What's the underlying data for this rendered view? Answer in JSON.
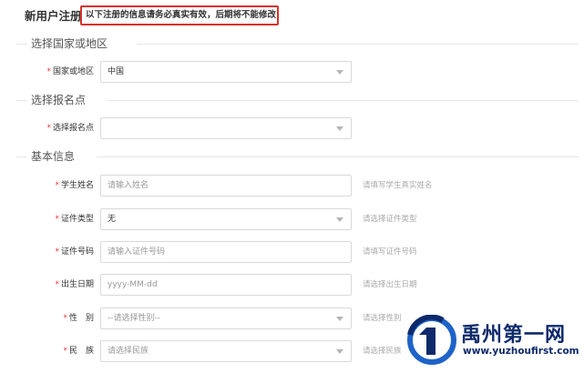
{
  "header": {
    "title": "新用户注册",
    "notice": "以下注册的信息请务必真实有效，后期将不能修改"
  },
  "sections": {
    "country": {
      "title": "选择国家或地区",
      "fields": {
        "country": {
          "label": "国家或地区",
          "value": "中国"
        }
      }
    },
    "signup_point": {
      "title": "选择报名点",
      "fields": {
        "point": {
          "label": "选择报名点",
          "value": ""
        }
      }
    },
    "basic": {
      "title": "基本信息",
      "fields": {
        "name": {
          "label": "学生姓名",
          "placeholder": "请输入姓名",
          "hint": "请填写学生真实姓名"
        },
        "id_type": {
          "label": "证件类型",
          "value": "无",
          "hint": "请选择证件类型"
        },
        "id_number": {
          "label": "证件号码",
          "placeholder": "请输入证件号码",
          "hint": "请填写证件号码"
        },
        "birth": {
          "label": "出生日期",
          "placeholder": "yyyy-MM-dd",
          "hint": "请选择出生日期"
        },
        "gender": {
          "label": "性　别",
          "value": "--请选择性别--",
          "hint": "请选择性别"
        },
        "ethnicity": {
          "label": "民　族",
          "value": "请选择民族",
          "hint": "请选择民族"
        }
      }
    }
  },
  "required_mark": "*",
  "watermark": {
    "name": "禹州第一网",
    "url": "www.yuzhoufirst.com"
  },
  "colors": {
    "accent_red": "#d9322c",
    "required": "#e0393e",
    "watermark_blue": "#0d2a6b"
  }
}
